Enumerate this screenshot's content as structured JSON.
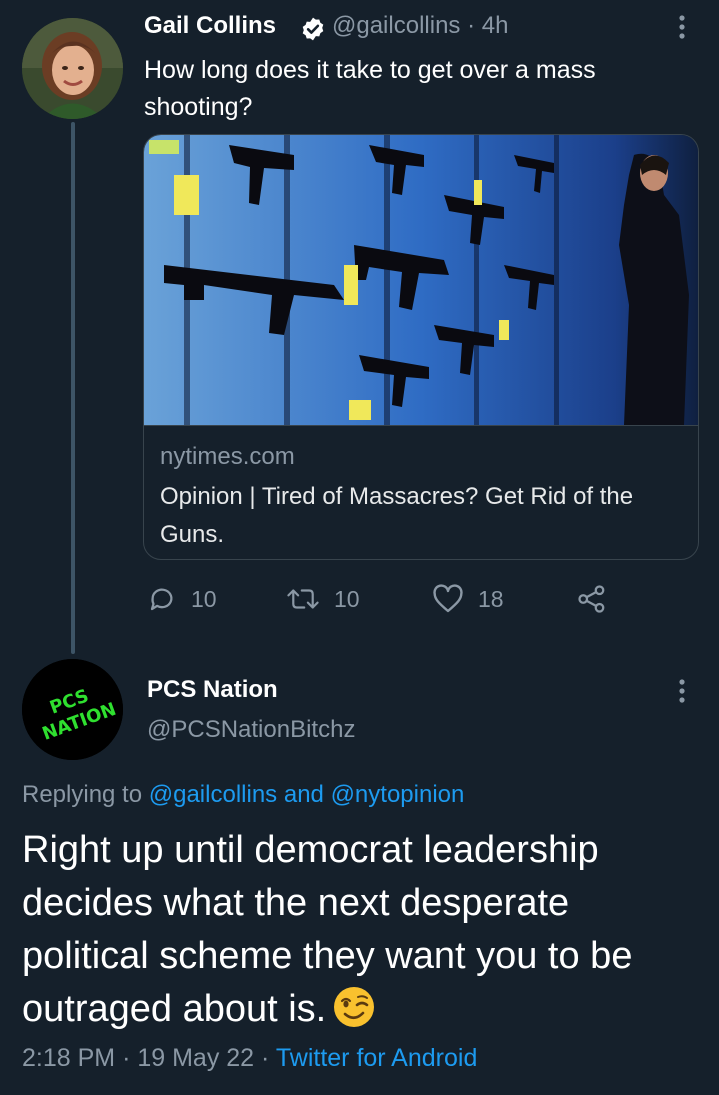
{
  "tweet1": {
    "author_name": "Gail Collins",
    "handle": "@gailcollins",
    "separator": "·",
    "time": "4h",
    "text": "How long does it take to get over a mass shooting?",
    "card": {
      "domain": "nytimes.com",
      "title": "Opinion | Tired of Massacres? Get Rid of the Guns."
    },
    "actions": {
      "replies": "10",
      "retweets": "10",
      "likes": "18"
    }
  },
  "tweet2": {
    "author_name": "PCS Nation",
    "handle": "@PCSNationBitchz",
    "avatar_text": "PCS NATION",
    "replying_prefix": "Replying to",
    "replying_user1": "@gailcollins",
    "replying_and": "and",
    "replying_user2": "@nytopinion",
    "text": "Right up until democrat leadership decides what the next desperate political scheme they want you to be outraged about is.",
    "emoji": "winking-face-emoji",
    "time": "2:18 PM",
    "dot": "·",
    "date": "19 May 22",
    "source": "Twitter for Android"
  },
  "colors": {
    "background": "#15202b",
    "secondary_text": "#8b98a5",
    "link": "#1d9bf0",
    "verified_badge": "#ffffff",
    "thread_line": "#3d5466",
    "avatar_text_green": "#2fe02f"
  },
  "icons": [
    "verified-badge-icon",
    "more-options-icon",
    "reply-icon",
    "retweet-icon",
    "like-icon",
    "share-icon",
    "winking-face-emoji"
  ]
}
